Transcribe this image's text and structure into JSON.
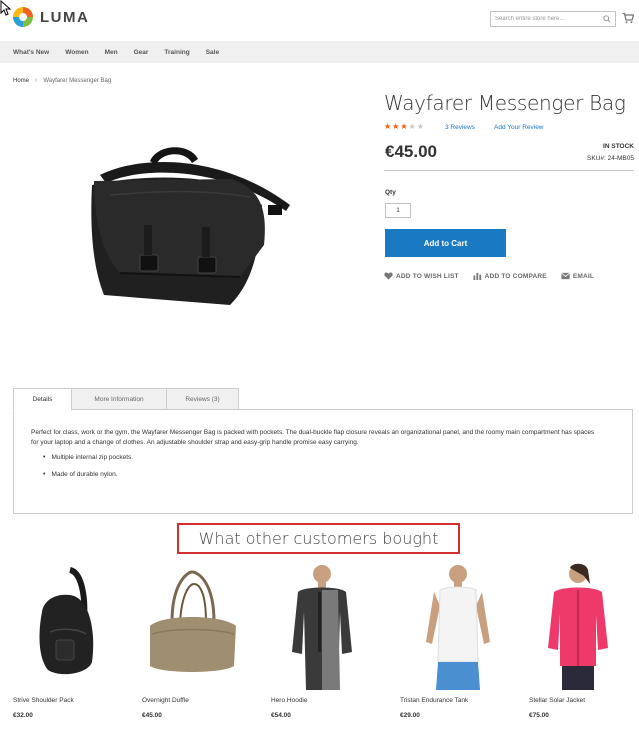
{
  "header": {
    "logo_text": "LUMA",
    "search_placeholder": "Search entire store here...",
    "icons": [
      "luma-logo-icon",
      "search-icon",
      "cart-icon"
    ]
  },
  "nav": {
    "items": [
      "What's New",
      "Women",
      "Men",
      "Gear",
      "Training",
      "Sale"
    ]
  },
  "breadcrumb": {
    "home": "Home",
    "current": "Wayfarer Messenger Bag"
  },
  "product": {
    "title": "Wayfarer Messenger Bag",
    "rating_stars": 3,
    "rating_max": 5,
    "reviews_link": "3 Reviews",
    "add_review_link": "Add Your Review",
    "price": "€45.00",
    "stock": "IN STOCK",
    "sku": "SKU#:  24-MB05",
    "qty_label": "Qty",
    "qty_value": "1",
    "add_to_cart": "Add to Cart",
    "actions": {
      "wishlist": "ADD TO WISH LIST",
      "compare": "ADD TO COMPARE",
      "email": "EMAIL"
    }
  },
  "tabs": {
    "details": "Details",
    "more_info": "More Information",
    "reviews": "Reviews (3)"
  },
  "details": {
    "description": "Perfect for class, work or the gym, the Wayfarer Messenger Bag is packed with pockets. The dual-buckle flap closure reveals an organizational panel, and the roomy main compartment has spaces for your laptop and a change of clothes. An adjustable shoulder strap and easy-grip handle promise easy carrying.",
    "bullets": [
      "Multiple internal zip pockets.",
      "Made of durable nylon."
    ]
  },
  "related": {
    "title": "What other customers bought",
    "items": [
      {
        "name": "Strive Shoulder Pack",
        "price": "€32.00"
      },
      {
        "name": "Overnight Duffle",
        "price": "€45.00"
      },
      {
        "name": "Hero Hoodie",
        "price": "€54.00"
      },
      {
        "name": "Tristan Endurance Tank",
        "price": "€29.00"
      },
      {
        "name": "Stellar Solar Jacket",
        "price": "€75.00"
      }
    ]
  },
  "colors": {
    "primary": "#1979c3",
    "star": "#ff5501",
    "highlight_border": "#d32f2f"
  }
}
